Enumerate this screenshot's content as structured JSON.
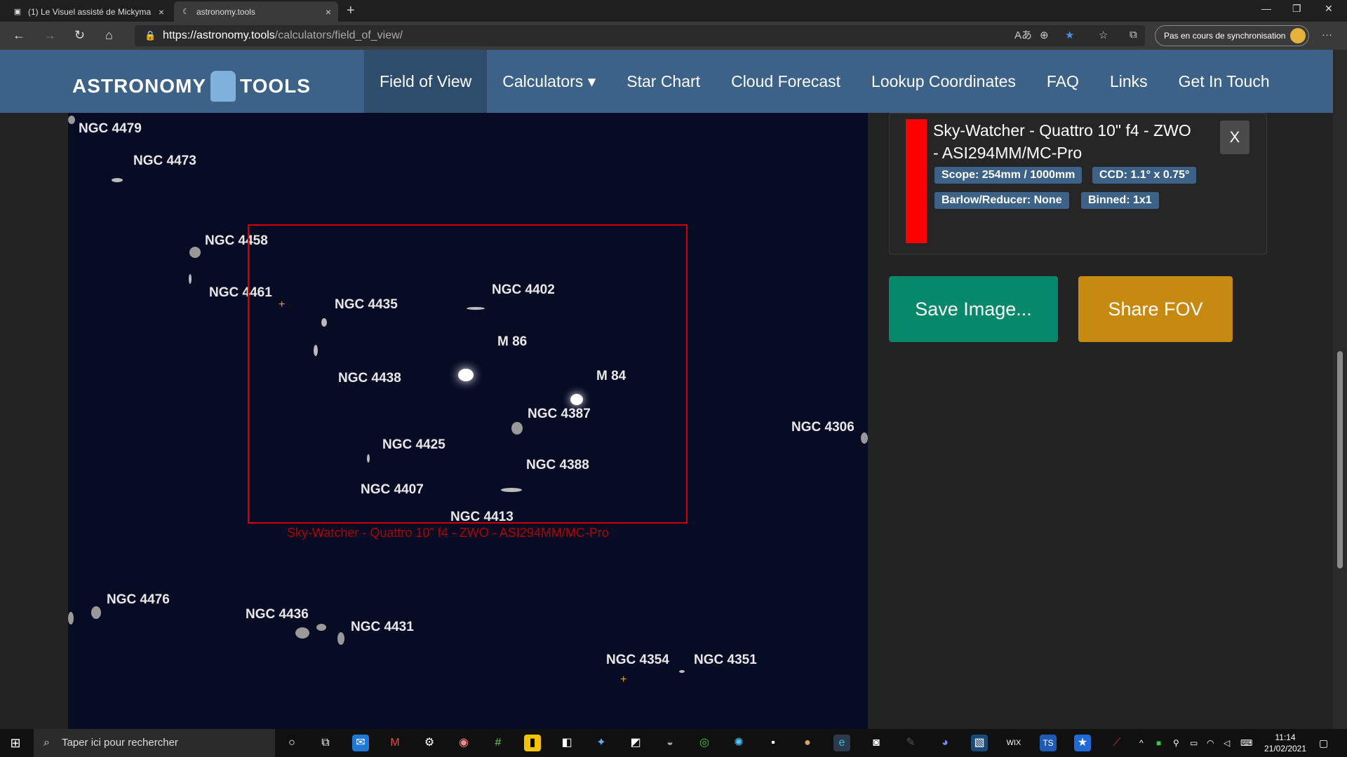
{
  "browser": {
    "tabs": [
      {
        "title": "(1) Le Visuel assisté de Mickyma",
        "icon": "page-icon"
      },
      {
        "title": "astronomy.tools",
        "icon": "moon-icon"
      }
    ],
    "url_main": "https://astronomy.tools",
    "url_path": "/calculators/field_of_view/",
    "sync_label": "Pas en cours de synchronisation"
  },
  "site": {
    "logo_left": "ASTRONOMY",
    "logo_right": "TOOLS",
    "menu": [
      "Field of View",
      "Calculators ▾",
      "Star Chart",
      "Cloud Forecast",
      "Lookup Coordinates",
      "FAQ",
      "Links",
      "Get In Touch"
    ],
    "active_menu": "Field of View"
  },
  "sky": {
    "objects": [
      "NGC 4479",
      "NGC 4473",
      "NGC 4458",
      "NGC 4461",
      "NGC 4435",
      "NGC 4402",
      "M 86",
      "NGC 4438",
      "M 84",
      "NGC 4387",
      "NGC 4306",
      "NGC 4425",
      "NGC 4388",
      "NGC 4407",
      "NGC 4413",
      "NGC 4476",
      "NGC 4436",
      "NGC 4431",
      "NGC 4354",
      "NGC 4351"
    ],
    "fov_label": "Sky-Watcher - Quattro 10\" f4 - ZWO - ASI294MM/MC-Pro",
    "fov_color": "#d20000"
  },
  "card": {
    "title": "Sky-Watcher - Quattro 10\" f4 - ZWO - ASI294MM/MC-Pro",
    "close": "X",
    "badges": [
      "Scope: 254mm / 1000mm",
      "CCD: 1.1° x 0.75°",
      "Barlow/Reducer: None",
      "Binned: 1x1"
    ],
    "color": "#ff0000"
  },
  "buttons": {
    "save": "Save Image...",
    "share": "Share FOV"
  },
  "taskbar": {
    "search_placeholder": "Taper ici pour rechercher",
    "time": "11:14",
    "date": "21/02/2021"
  }
}
